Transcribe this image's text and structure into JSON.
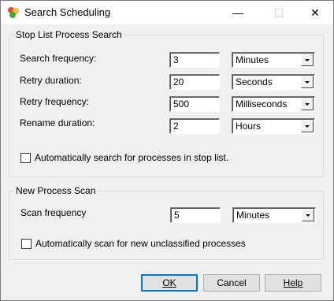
{
  "window": {
    "title": "Search Scheduling",
    "minimize": "—",
    "maximize": "☐",
    "close": "✕"
  },
  "stop_list": {
    "group_label": "Stop List Process Search",
    "rows": [
      {
        "label": "Search frequency:",
        "value": "3",
        "unit": "Minutes"
      },
      {
        "label": "Retry duration:",
        "value": "20",
        "unit": "Seconds"
      },
      {
        "label": "Retry frequency:",
        "value": "500",
        "unit": "Milliseconds"
      },
      {
        "label": "Rename duration:",
        "value": "2",
        "unit": "Hours"
      }
    ],
    "auto_label": "Automatically search for processes in stop list.",
    "auto_checked": false
  },
  "new_scan": {
    "group_label": "New Process Scan",
    "label": "Scan frequency",
    "value": "5",
    "unit": "Minutes",
    "auto_label": "Automatically scan for new unclassified processes",
    "auto_checked": false
  },
  "buttons": {
    "ok": "OK",
    "cancel": "Cancel",
    "help": "Help"
  }
}
